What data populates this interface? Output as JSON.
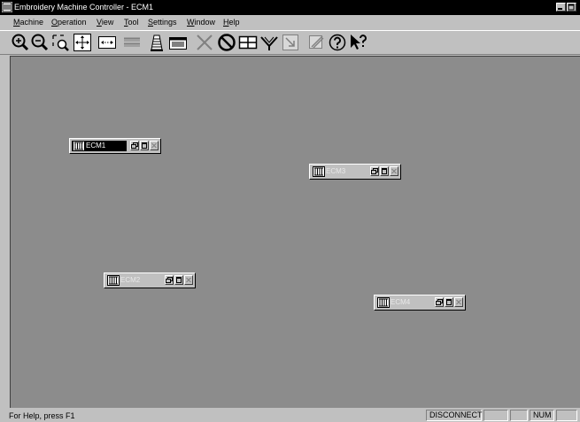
{
  "window": {
    "title": "Embroidery Machine Controller - ECM1",
    "controls": [
      {
        "icon": "minimize-icon"
      },
      {
        "icon": "restore-icon"
      }
    ]
  },
  "menubar": {
    "items": [
      {
        "acc": "M",
        "rest": "achine"
      },
      {
        "acc": "O",
        "rest": "peration"
      },
      {
        "acc": "V",
        "rest": "iew"
      },
      {
        "acc": "T",
        "rest": "ool"
      },
      {
        "acc": "S",
        "rest": "ettings"
      },
      {
        "acc": "W",
        "rest": "indow"
      },
      {
        "acc": "H",
        "rest": "elp"
      }
    ]
  },
  "toolbar": {
    "tools": [
      {
        "icon": "zoom-in-icon"
      },
      {
        "icon": "zoom-out-icon"
      },
      {
        "icon": "zoom-window-icon"
      },
      {
        "icon": "fit-to-window-icon"
      },
      {
        "icon": "actual-size-icon"
      },
      {
        "icon": "stitch-list-icon"
      },
      {
        "icon": "thread-cone-icon"
      },
      {
        "icon": "machine-panel-icon"
      },
      {
        "icon": "cancel-icon",
        "disabled": true
      },
      {
        "icon": "stop-icon"
      },
      {
        "icon": "tile-windows-icon"
      },
      {
        "icon": "connect-icon"
      },
      {
        "icon": "send-icon",
        "disabled": true
      },
      {
        "icon": "edit-design-icon",
        "disabled": true
      },
      {
        "icon": "help-icon"
      },
      {
        "icon": "context-help-icon"
      }
    ]
  },
  "mdi": {
    "windows": [
      {
        "name": "ECM1",
        "active": true
      },
      {
        "name": "ECM3",
        "active": false
      },
      {
        "name": "ECM2",
        "active": false
      },
      {
        "name": "ECM4",
        "active": false
      }
    ]
  },
  "statusbar": {
    "help": "For Help, press F1",
    "panels": [
      "DISCONNECT",
      "",
      "",
      "NUM",
      ""
    ]
  },
  "colors": {
    "title_bar": "#000000",
    "workspace": "#8c8c8c",
    "chrome": "#c0c0c0"
  }
}
